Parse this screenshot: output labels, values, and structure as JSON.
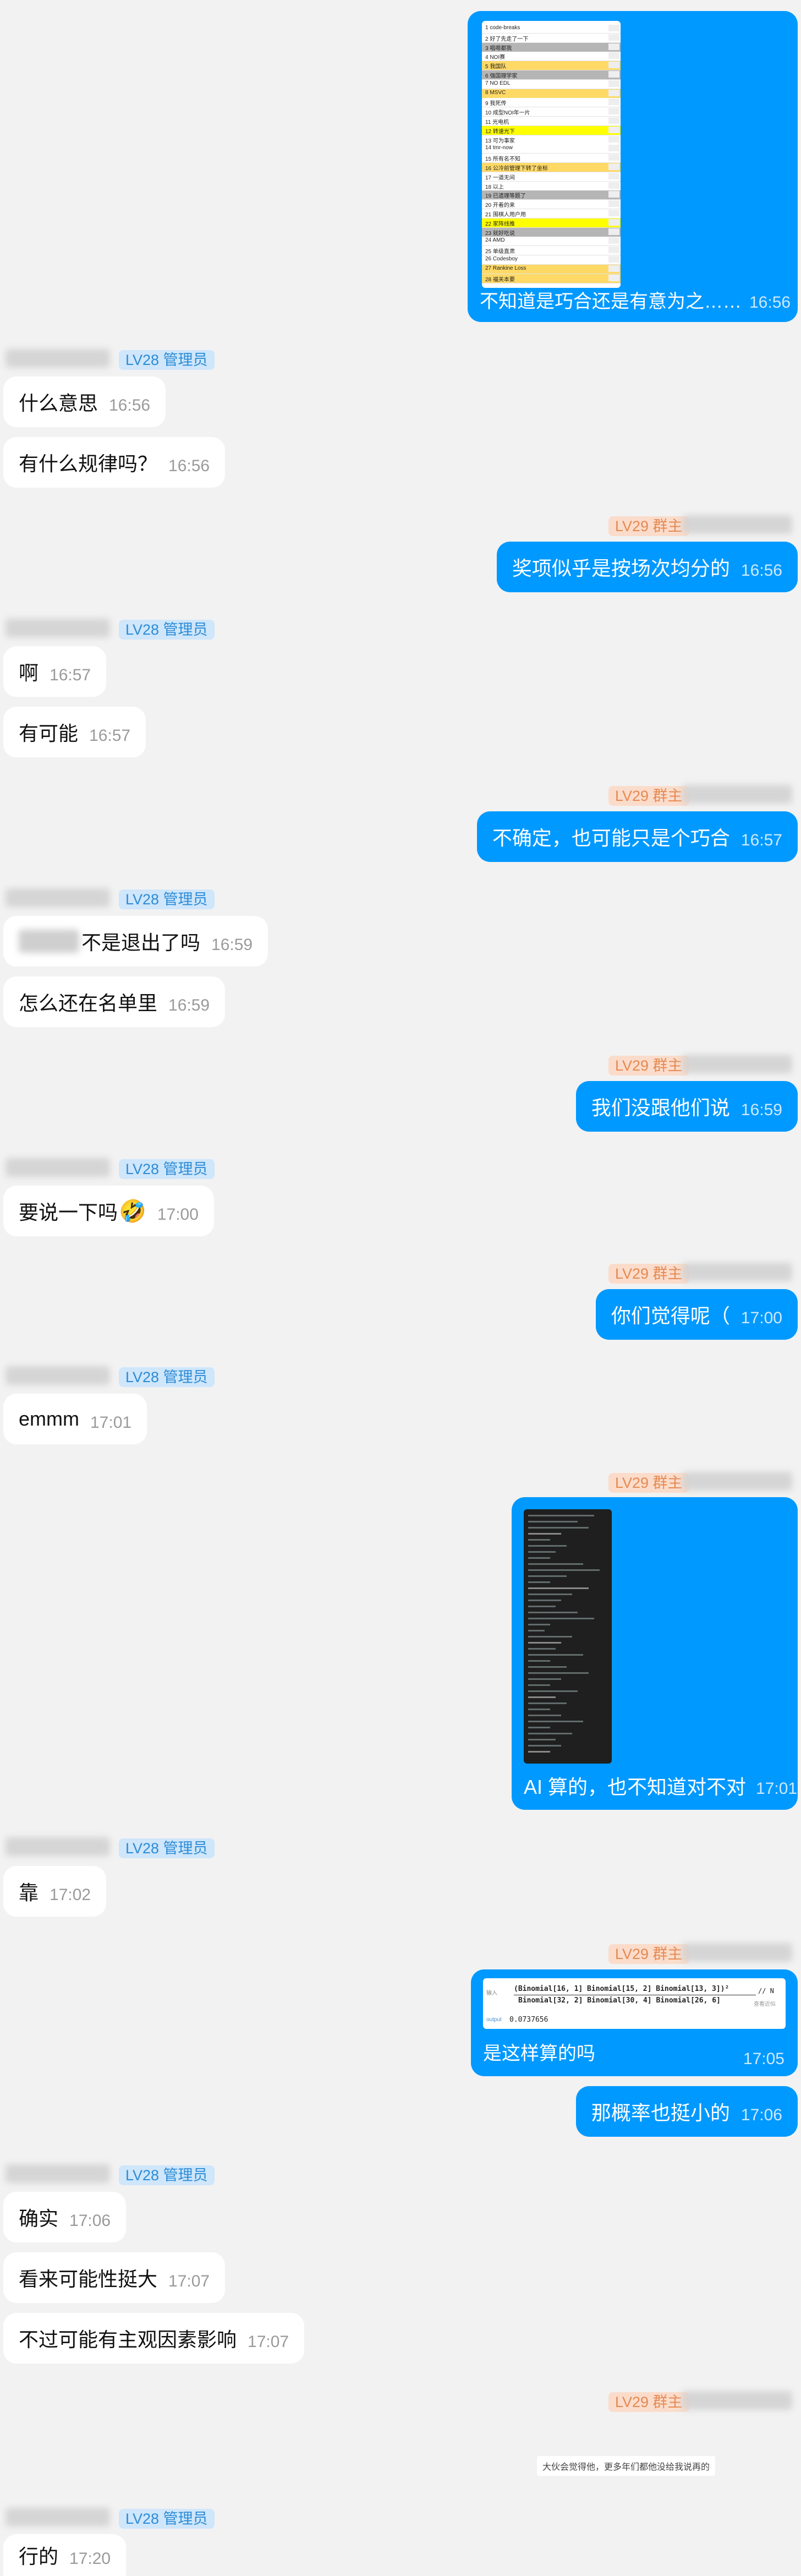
{
  "roles": {
    "admin": "LV28 管理员",
    "owner": "LV29 群主"
  },
  "messages": [
    {
      "text": "不知道是巧合还是有意为之……",
      "time": "16:56"
    },
    {
      "text": "什么意思",
      "time": "16:56"
    },
    {
      "text": "有什么规律吗？",
      "time": "16:56"
    },
    {
      "text": "奖项似乎是按场次均分的",
      "time": "16:56"
    },
    {
      "text": "啊",
      "time": "16:57"
    },
    {
      "text": "有可能",
      "time": "16:57"
    },
    {
      "text": "不确定，也可能只是个巧合",
      "time": "16:57"
    },
    {
      "text": "不是退出了吗",
      "time": "16:59"
    },
    {
      "text": "怎么还在名单里",
      "time": "16:59"
    },
    {
      "text": "我们没跟他们说",
      "time": "16:59"
    },
    {
      "text": "要说一下吗",
      "time": "17:00"
    },
    {
      "text": "你们觉得呢（",
      "time": "17:00"
    },
    {
      "text": "emmm",
      "time": "17:01"
    },
    {
      "text": "AI 算的，也不知道对不对",
      "time": "17:01"
    },
    {
      "text": "靠",
      "time": "17:02"
    },
    {
      "text": "是这样算的吗",
      "time": "17:05"
    },
    {
      "text": "那概率也挺小的",
      "time": "17:06"
    },
    {
      "text": "确实",
      "time": "17:06"
    },
    {
      "text": "看来可能性挺大",
      "time": "17:07"
    },
    {
      "text": "不过可能有主观因素影响",
      "time": "17:07"
    },
    {
      "text": "行的",
      "time": "17:20"
    }
  ],
  "emoji": "🤣",
  "spreadsheet_rows": [
    "1 code-breaks",
    "2 好了先走了一下",
    "3 唱嗯都我",
    "4 NOI赛",
    "5 我国队",
    "6 强国理学家",
    "7 NO EDL",
    "8 MSVC",
    "9 我死传",
    "10 成型NOI年一片",
    "11 光电机",
    "12 转速光下",
    "13 可为事家",
    "14 tmr-now",
    "15 所有名不知",
    "16 公冷前管理下转了坐标",
    "17 一道无间",
    "18 以上",
    "19 已遗理等题了",
    "20 开着的来",
    "21 围棋人用户用",
    "22 家阵线推",
    "23 就好吃说",
    "24 AMD",
    "25 单级直肃",
    "26 Codesboy",
    "27 Rankine Loss",
    "28 福关本要"
  ],
  "formula": {
    "caption": "输入",
    "expr_line1": "(Binomial[16, 1] Binomial[15, 2] Binomial[13, 3])²",
    "expr_comment": "// N",
    "expr_line2": "Binomial[32, 2] Binomial[30, 4] Binomial[26, 6]",
    "side_note": "查看近似",
    "output_label": "output",
    "result": "0.0737656"
  },
  "system_notice": "大伙会觉得他，更多年们都他没给我说再的"
}
